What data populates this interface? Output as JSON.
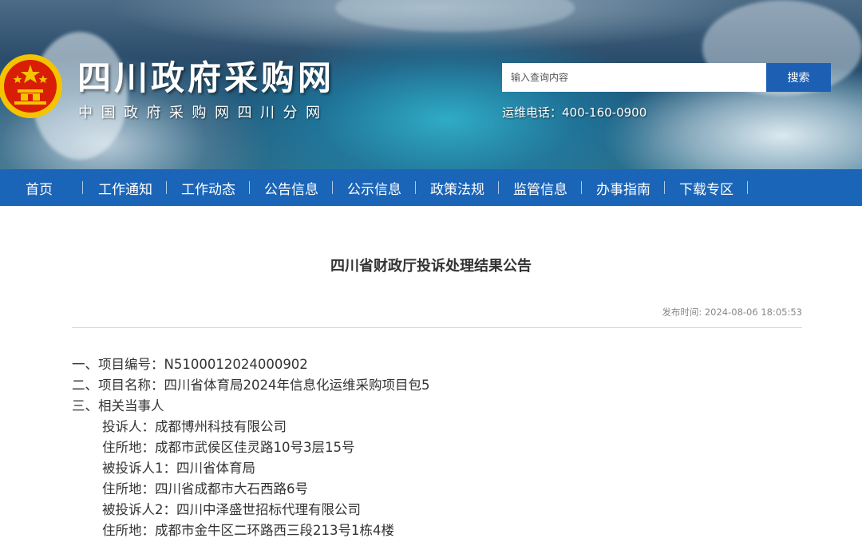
{
  "header": {
    "site_title": "四川政府采购网",
    "site_subtitle": "中国政府采购网四川分网",
    "search": {
      "placeholder": "输入查询内容",
      "button_label": "搜索"
    },
    "hotline": "运维电话：400-160-0900"
  },
  "nav": {
    "items": [
      {
        "label": "首页"
      },
      {
        "label": "工作通知"
      },
      {
        "label": "工作动态"
      },
      {
        "label": "公告信息"
      },
      {
        "label": "公示信息"
      },
      {
        "label": "政策法规"
      },
      {
        "label": "监管信息"
      },
      {
        "label": "办事指南"
      },
      {
        "label": "下载专区"
      }
    ]
  },
  "article": {
    "title": "四川省财政厅投诉处理结果公告",
    "publish_time": "发布时间: 2024-08-06 18:05:53",
    "lines": [
      {
        "text": "一、项目编号：N5100012024000902"
      },
      {
        "text": "二、项目名称：四川省体育局2024年信息化运维采购项目包5"
      },
      {
        "text": "三、相关当事人"
      },
      {
        "text": "投诉人：成都博州科技有限公司"
      },
      {
        "text": "住所地：成都市武侯区佳灵路10号3层15号"
      },
      {
        "text": "被投诉人1：四川省体育局"
      },
      {
        "text": "住所地：四川省成都市大石西路6号"
      },
      {
        "text": "被投诉人2：四川中泽盛世招标代理有限公司"
      },
      {
        "text": "住所地：成都市金牛区二环路西三段213号1栋4楼"
      }
    ]
  },
  "colors": {
    "nav_bg": "#1b65b8",
    "search_button": "#1d5fb2",
    "emblem_red": "#d81e06",
    "emblem_gold": "#f5c400"
  },
  "icons": {
    "emblem": "national-emblem-icon"
  }
}
